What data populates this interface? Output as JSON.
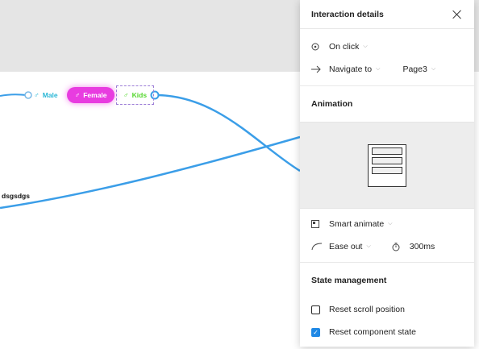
{
  "canvas": {
    "component": {
      "male_label": "Male",
      "female_label": "Female",
      "kids_label": "Kids",
      "gender_glyph": "♂"
    },
    "text_layer": "dsgsdgs"
  },
  "panel": {
    "title": "Interaction details",
    "trigger": {
      "label": "On click"
    },
    "action": {
      "label": "Navigate to",
      "destination": "Page3"
    },
    "animation": {
      "title": "Animation",
      "type": "Smart animate",
      "easing": "Ease out",
      "duration": "300ms"
    },
    "state": {
      "title": "State management",
      "reset_scroll": {
        "label": "Reset scroll position",
        "checked": false
      },
      "reset_component": {
        "label": "Reset component state",
        "checked": true
      }
    }
  },
  "colors": {
    "connector": "#3b9ee8",
    "female_bg": "#e83ce0",
    "male_text": "#2ab7d6",
    "kids_text": "#55d72e",
    "checkbox_accent": "#1e88e5"
  }
}
